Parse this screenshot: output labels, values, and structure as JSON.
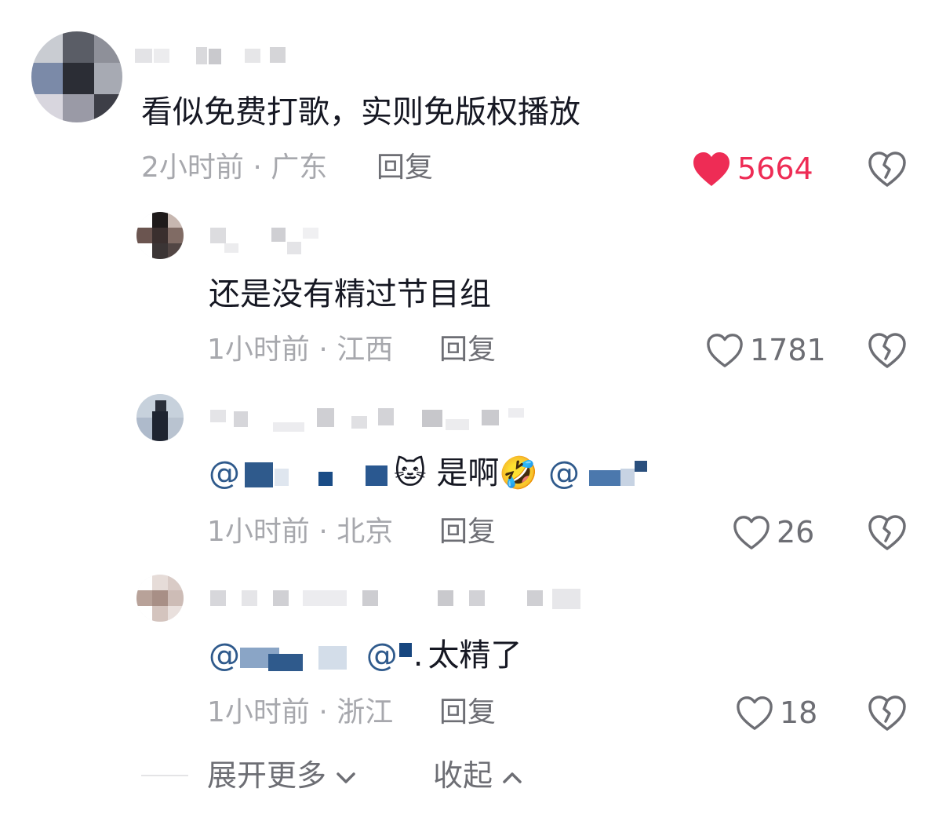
{
  "comments": [
    {
      "text": "看似免费打歌，实则免版权播放",
      "time": "2小时前",
      "location": "广东",
      "reply_label": "回复",
      "likes": "5664",
      "liked": true
    },
    {
      "text": "还是没有精过节目组",
      "time": "1小时前",
      "location": "江西",
      "reply_label": "回复",
      "likes": "1781",
      "liked": false
    },
    {
      "text_parts": {
        "mention1_prefix": "@",
        "mention1_suffix": "",
        "emoji1": "🐱",
        "mid": "是啊",
        "emoji2": "🤣",
        "mention2_prefix": "@"
      },
      "time": "1小时前",
      "location": "北京",
      "reply_label": "回复",
      "likes": "26",
      "liked": false
    },
    {
      "text_parts": {
        "mention1_prefix": "@",
        "mention2_prefix": "@",
        "mention2_suffix": ".",
        "tail": "太精了"
      },
      "time": "1小时前",
      "location": "浙江",
      "reply_label": "回复",
      "likes": "18",
      "liked": false
    }
  ],
  "separator": " · ",
  "footer": {
    "expand_label": "展开更多",
    "collapse_label": "收起"
  },
  "colors": {
    "like_active": "#ee2c55",
    "mention": "#2f5a8c",
    "meta": "#a7a8ad",
    "text": "#161823"
  },
  "icons": {
    "like": "heart-outline-icon",
    "like_active": "heart-filled-icon",
    "dislike": "broken-heart-icon",
    "expand": "chevron-down-icon",
    "collapse": "chevron-up-icon"
  }
}
